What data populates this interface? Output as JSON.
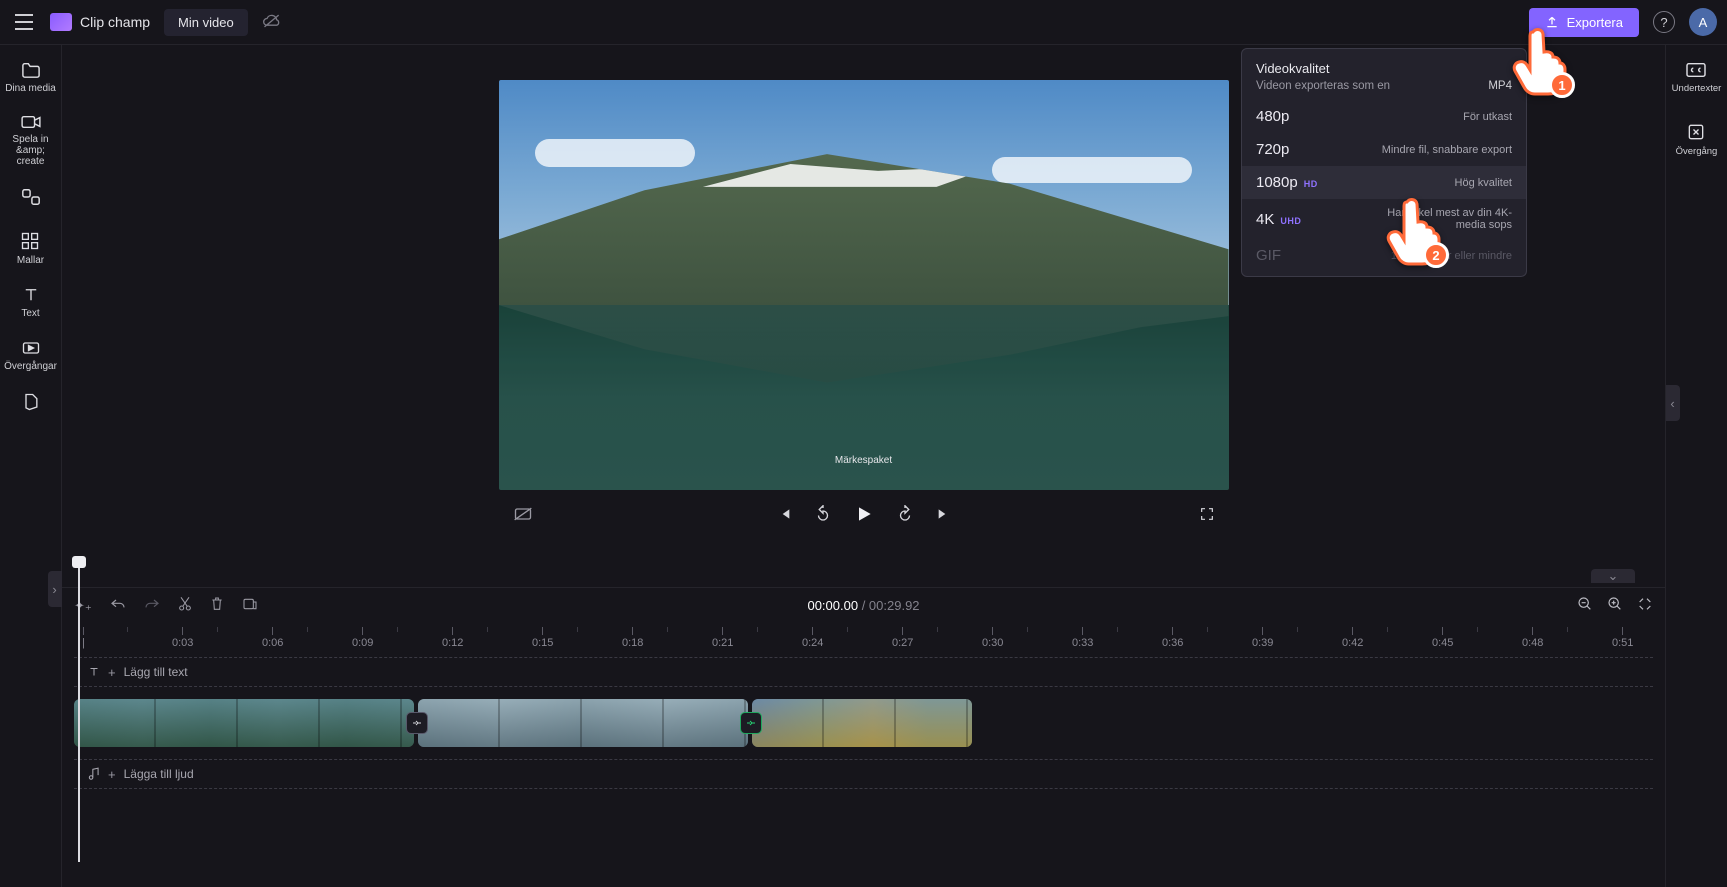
{
  "topbar": {
    "brand": "Clip champ",
    "project_name": "Min video",
    "export_label": "Exportera",
    "avatar_letter": "A"
  },
  "leftnav": {
    "items": [
      {
        "id": "media",
        "label": "Dina media"
      },
      {
        "id": "record",
        "label": "Spela in &amp; create"
      },
      {
        "id": "content",
        "label": ""
      },
      {
        "id": "templates",
        "label": "Mallar"
      },
      {
        "id": "text",
        "label": "Text"
      },
      {
        "id": "transitions",
        "label": "Övergångar"
      },
      {
        "id": "brand",
        "label": ""
      }
    ]
  },
  "rightnav": {
    "items": [
      {
        "id": "cc",
        "label": "Undertexter"
      },
      {
        "id": "transition",
        "label": "Övergång"
      }
    ]
  },
  "preview": {
    "watermark": "Märkespaket"
  },
  "player": {
    "current_time": "00:00.00",
    "total_time": "00:29.92"
  },
  "timeline": {
    "text_hint": "Lägg till text",
    "audio_hint": "Lägga till ljud",
    "ticks": [
      "|",
      "0:03",
      "0:06",
      "0:09",
      "0:12",
      "0:15",
      "0:18",
      "0:21",
      "0:24",
      "0:27",
      "0:30",
      "0:33",
      "0:36",
      "0:39",
      "0:42",
      "0:45",
      "0:48",
      "0:51"
    ]
  },
  "export_popover": {
    "title": "Videokvalitet",
    "subtitle": "Videon exporteras som en",
    "format": "MP4",
    "items": [
      {
        "res": "480p",
        "badge": "",
        "desc": "För utkast",
        "disabled": false
      },
      {
        "res": "720p",
        "badge": "",
        "desc": "Mindre fil, snabbare export",
        "disabled": false
      },
      {
        "res": "1080p",
        "badge": "HD",
        "desc": "Hög kvalitet",
        "disabled": false
      },
      {
        "res": "4K",
        "badge": "UHD",
        "desc": "Hanyckel mest av din 4K-media sops",
        "disabled": false
      },
      {
        "res": "GIF",
        "badge": "",
        "desc": "15 sekunder eller mindre",
        "disabled": true
      }
    ]
  },
  "annotations": {
    "step1": "1",
    "step2": "2"
  }
}
